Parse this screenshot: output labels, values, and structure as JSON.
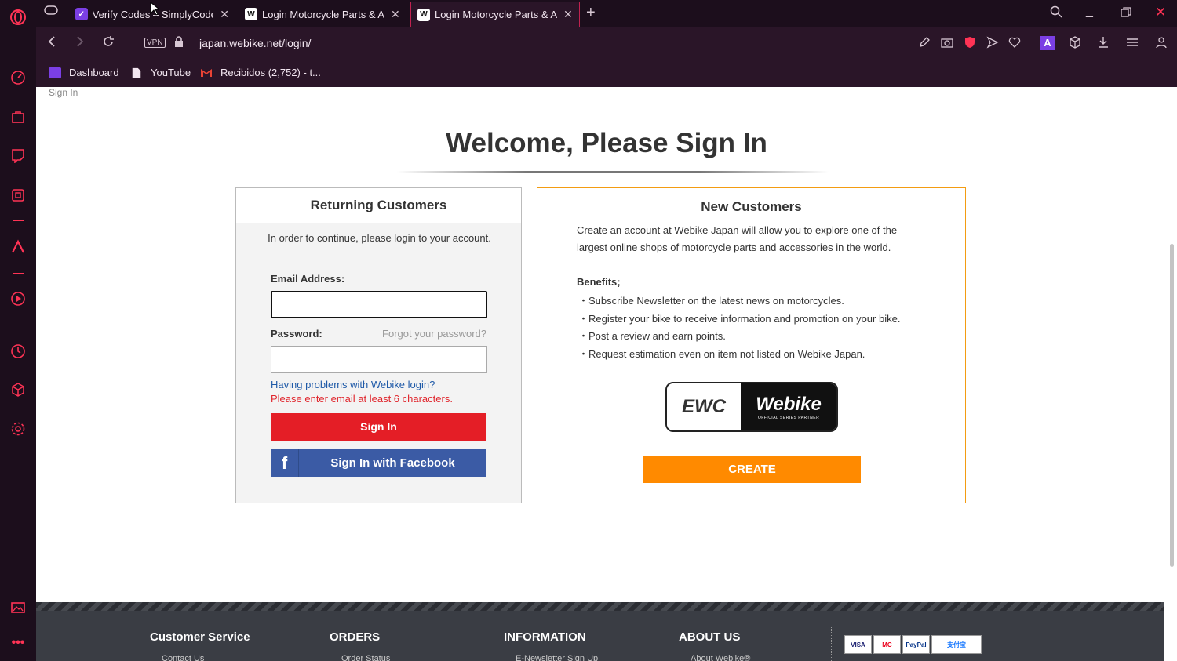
{
  "tabs": [
    {
      "title": "Verify Codes – SimplyCodes",
      "active": false
    },
    {
      "title": "Login Motorcycle Parts & Accessories",
      "active": false
    },
    {
      "title": "Login Motorcycle Parts & Accessories",
      "active": true
    }
  ],
  "address": {
    "url": "japan.webike.net/login/",
    "vpn": "VPN"
  },
  "bookmarks": [
    {
      "label": "Dashboard"
    },
    {
      "label": "YouTube"
    },
    {
      "label": "Recibidos (2,752) - t..."
    }
  ],
  "page": {
    "breadcrumb": "Sign In",
    "heading": "Welcome, Please Sign In",
    "returning": {
      "title": "Returning Customers",
      "intro": "In order to continue, please login to your account.",
      "email_label": "Email Address:",
      "email_value": "",
      "password_label": "Password:",
      "password_value": "",
      "forgot": "Forgot your password?",
      "help": "Having problems with Webike login?",
      "error": "Please enter email at least 6 characters.",
      "signin": "Sign In",
      "facebook": "Sign In with Facebook",
      "facebook_icon": "f"
    },
    "new": {
      "title": "New Customers",
      "desc": "Create an account at Webike Japan will allow you to explore one of the largest online shops of motorcycle parts and accessories in the world.",
      "benefits_heading": "Benefits;",
      "benefits": [
        "・Subscribe Newsletter on the latest news on motorcycles.",
        "・Register your bike to receive information and promotion on your bike.",
        "・Post a review and earn points.",
        "・Request estimation even on item not listed on Webike Japan."
      ],
      "logo_left": "EWC",
      "logo_right": "Webike",
      "logo_sub": "OFFICIAL SERIES PARTNER",
      "create": "CREATE"
    },
    "footer": {
      "columns": [
        {
          "title": "Customer Service",
          "first": "Contact Us"
        },
        {
          "title": "ORDERS",
          "first": "Order Status"
        },
        {
          "title": "INFORMATION",
          "first": "E-Newsletter Sign Up"
        },
        {
          "title": "ABOUT US",
          "first": "About Webike®"
        }
      ],
      "payments": [
        "VISA",
        "MC",
        "PayPal",
        "支付宝"
      ]
    }
  },
  "colors": {
    "accent_red": "#e41e26",
    "facebook_blue": "#3b5ba5",
    "create_orange": "#ff8a00",
    "link_blue": "#1f5aa8"
  }
}
